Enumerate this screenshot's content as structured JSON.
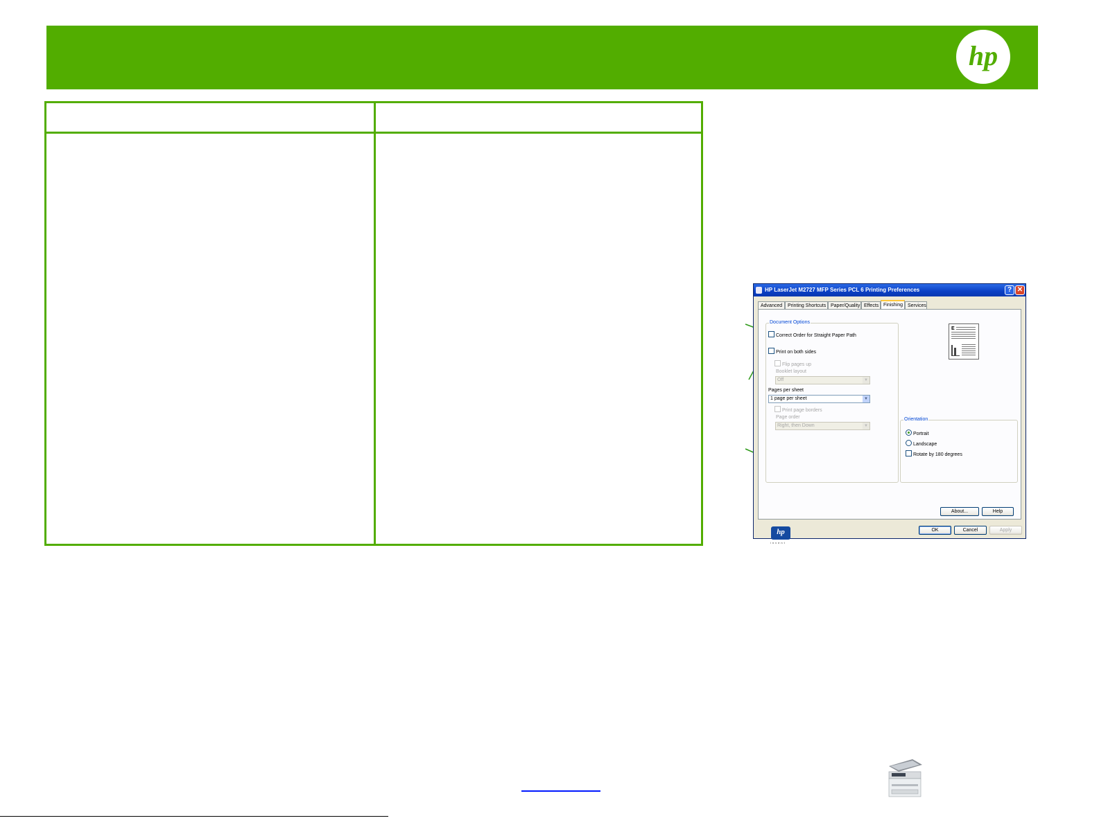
{
  "dialog": {
    "title": "HP LaserJet M2727 MFP Series PCL 6 Printing Preferences",
    "help_glyph": "?",
    "close_glyph": "✕",
    "tabs": [
      {
        "label": "Advanced"
      },
      {
        "label": "Printing Shortcuts"
      },
      {
        "label": "Paper/Quality"
      },
      {
        "label": "Effects"
      },
      {
        "label": "Finishing"
      },
      {
        "label": "Services"
      }
    ],
    "active_tab": "Finishing",
    "document_options": {
      "label": "Document Options",
      "correct_order": "Correct Order for Straight Paper Path",
      "print_both_sides": "Print on both sides",
      "flip_pages_up": "Flip pages up",
      "booklet_layout_label": "Booklet layout",
      "booklet_layout_value": "Off",
      "pages_per_sheet_label": "Pages per sheet",
      "pages_per_sheet_value": "1 page per sheet",
      "print_page_borders": "Print page borders",
      "page_order_label": "Page order",
      "page_order_value": "Right, then Down"
    },
    "orientation": {
      "label": "Orientation",
      "portrait": "Portrait",
      "landscape": "Landscape",
      "rotate": "Rotate by 180 degrees",
      "selected": "Portrait"
    },
    "buttons": {
      "about": "About...",
      "help": "Help",
      "ok": "OK",
      "cancel": "Cancel",
      "apply": "Apply"
    },
    "logo_text": "hp",
    "logo_sub": "invent"
  },
  "header": {
    "logo_text": "hp"
  },
  "colors": {
    "brand_green": "#52ad00",
    "callout_line": "#2f9a1a"
  }
}
